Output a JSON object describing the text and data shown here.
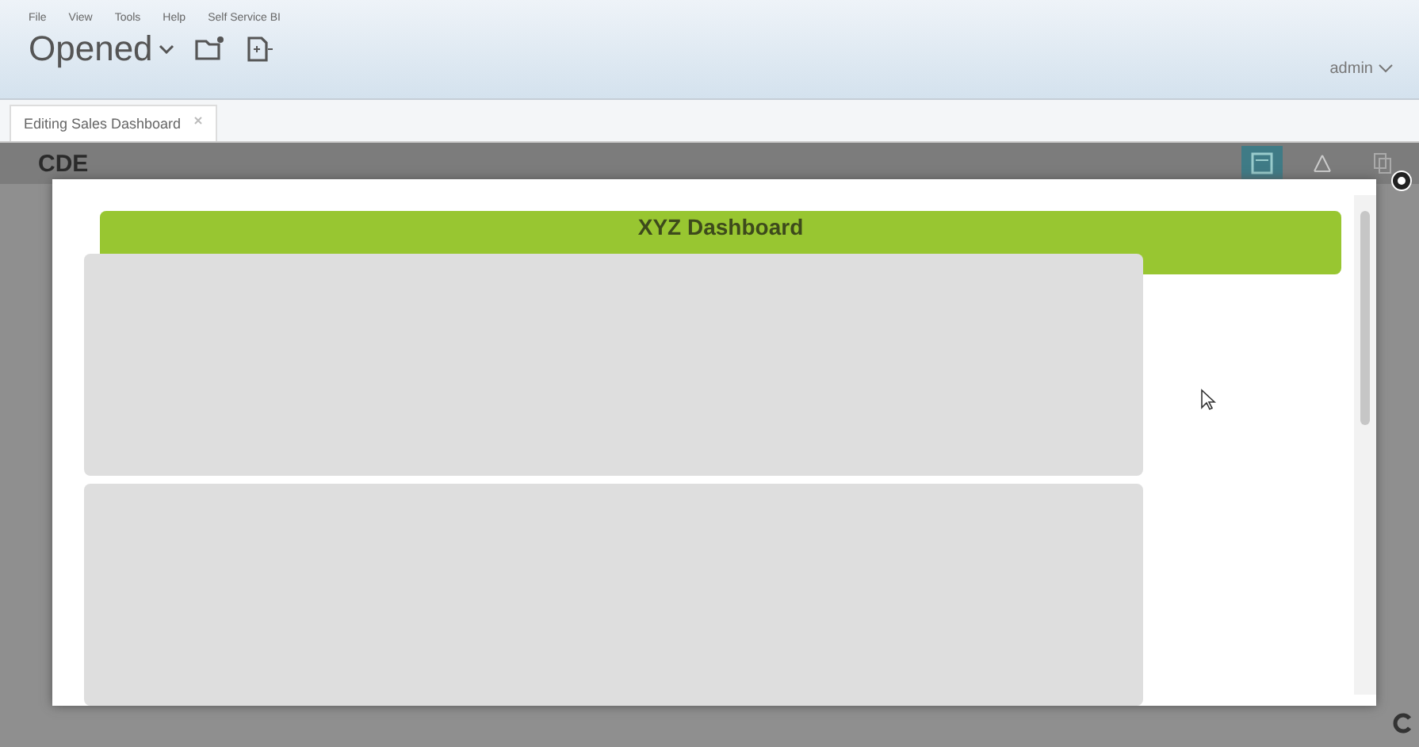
{
  "menu": [
    "File",
    "View",
    "Tools",
    "Help",
    "Self Service BI"
  ],
  "perspective": {
    "label": "Opened"
  },
  "user": {
    "label": "admin"
  },
  "tabs": [
    {
      "label": "Editing Sales Dashboard",
      "selected": true
    }
  ],
  "cde": {
    "logo": "CDE",
    "views": [
      {
        "selected": true
      },
      {
        "selected": false
      },
      {
        "selected": false
      }
    ]
  },
  "preview": {
    "title": "XYZ Dashboard"
  }
}
